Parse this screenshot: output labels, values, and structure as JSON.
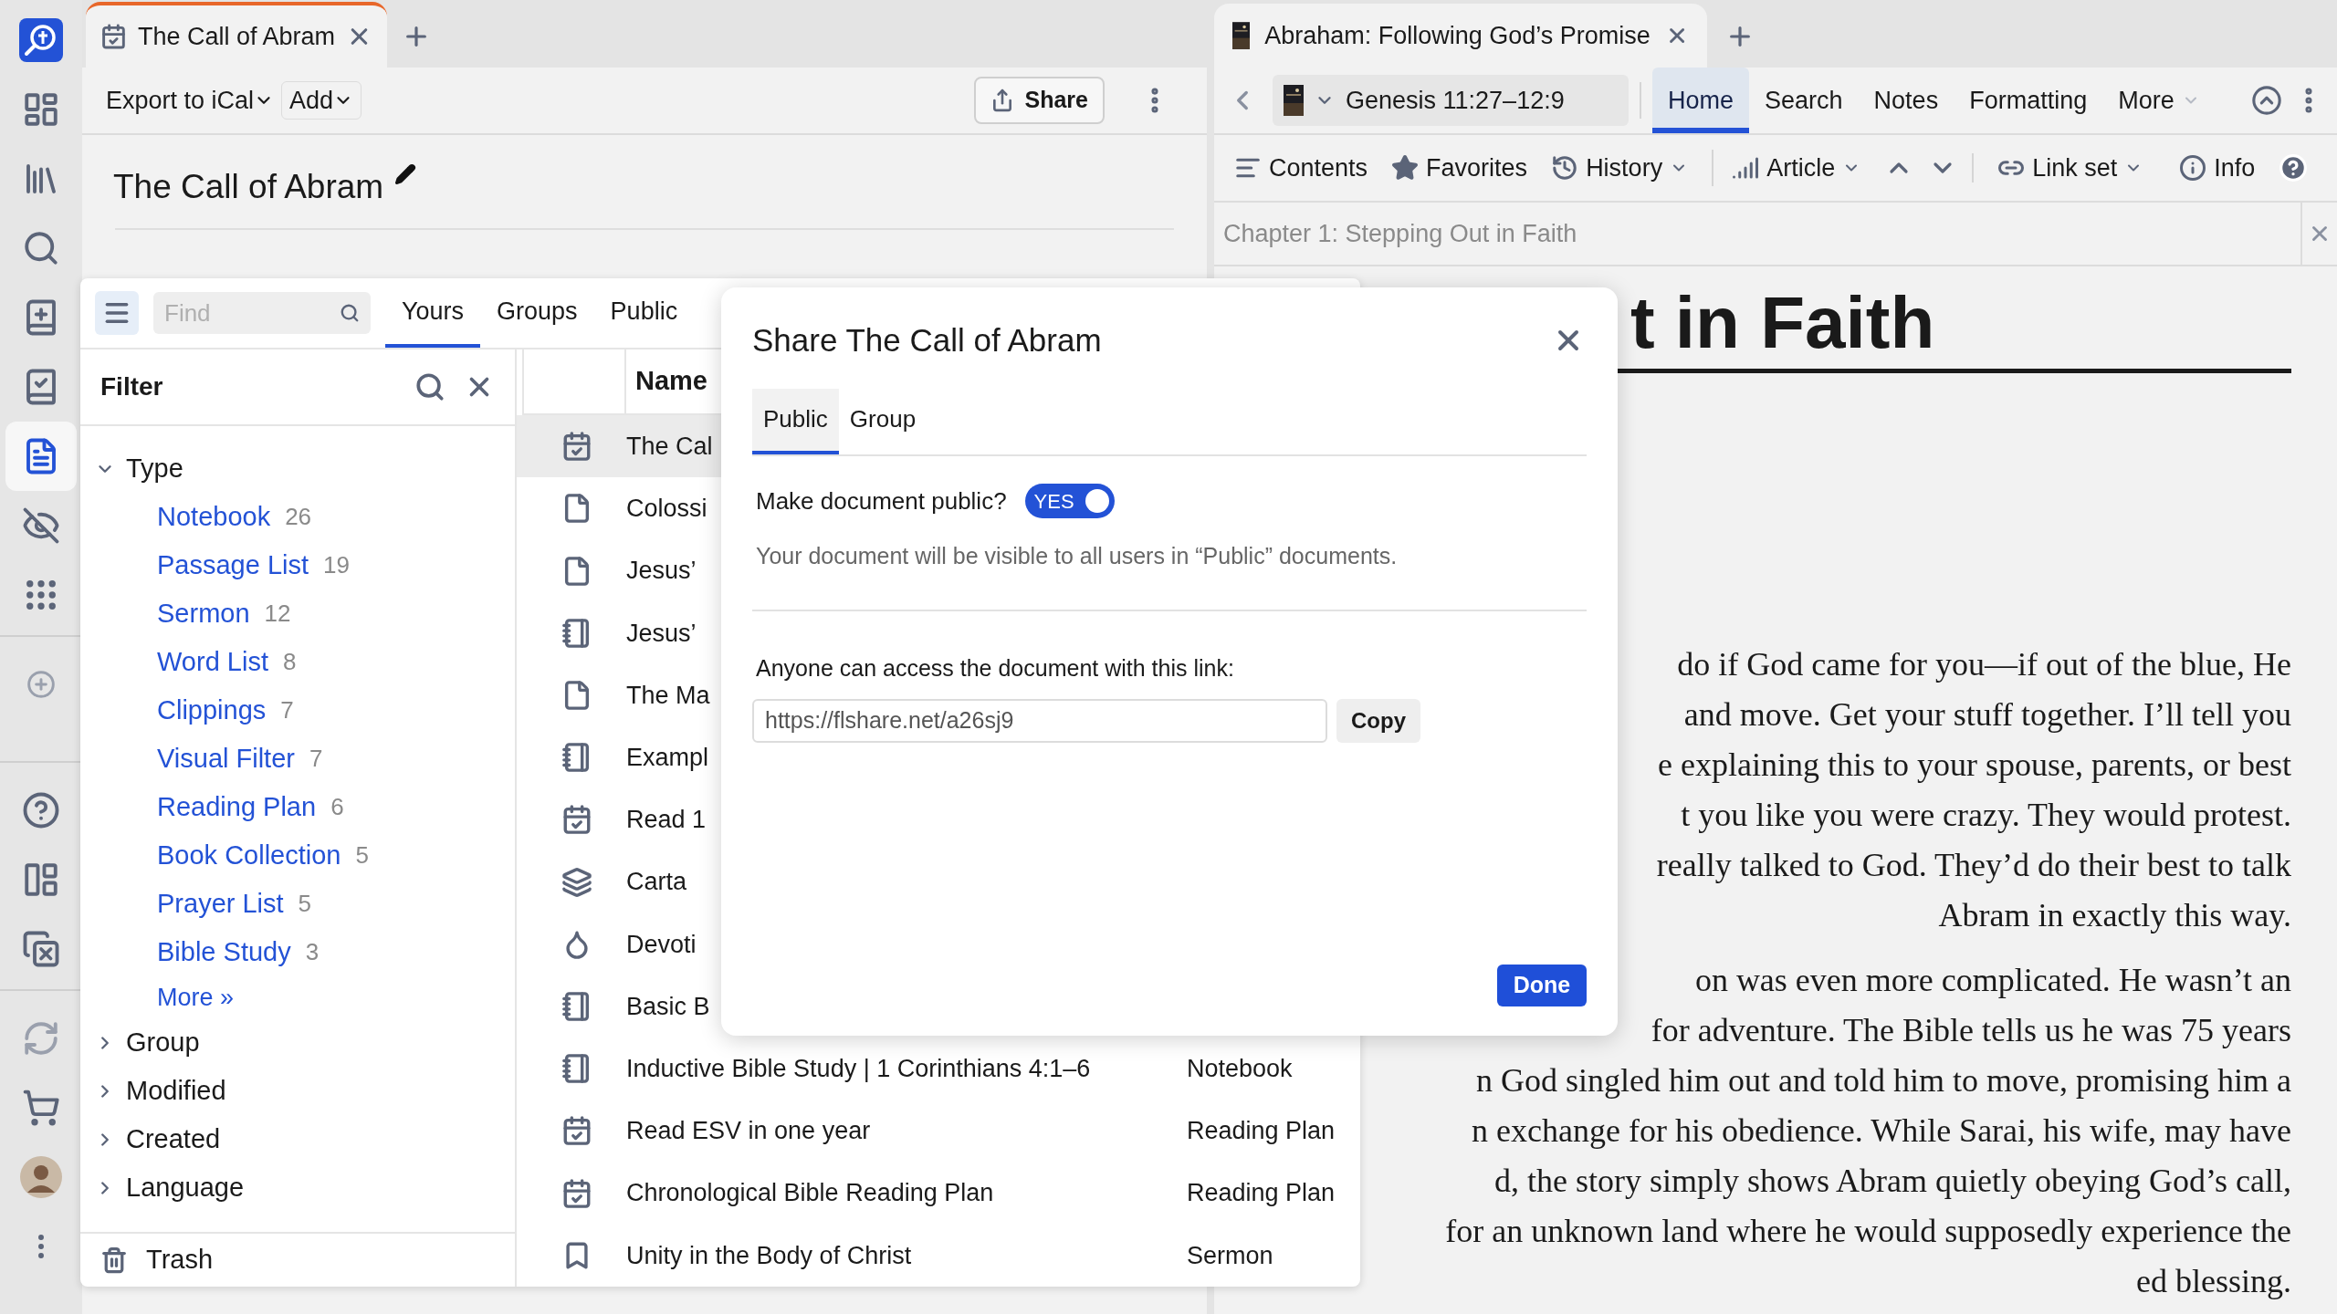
{
  "rail": [
    {
      "items": [
        {
          "kind": "logo",
          "selected": false
        },
        {
          "kind": "dashboard",
          "selected": false
        },
        {
          "kind": "library",
          "selected": false
        },
        {
          "kind": "search",
          "selected": false
        },
        {
          "kind": "add-book",
          "selected": false
        },
        {
          "kind": "check-book",
          "selected": false
        },
        {
          "kind": "document",
          "selected": true
        },
        {
          "kind": "eye-off",
          "selected": false
        },
        {
          "kind": "apps",
          "selected": false
        }
      ]
    },
    {
      "items": [
        {
          "kind": "add",
          "selected": false
        }
      ]
    },
    {
      "items": [
        {
          "kind": "help",
          "selected": false
        },
        {
          "kind": "layout",
          "selected": false
        },
        {
          "kind": "close-copy",
          "selected": false
        }
      ]
    },
    {
      "items": [
        {
          "kind": "sync",
          "selected": false
        },
        {
          "kind": "cart",
          "selected": false
        },
        {
          "kind": "avatar",
          "selected": false
        },
        {
          "kind": "more",
          "selected": false
        }
      ]
    }
  ],
  "left_window": {
    "tab": {
      "title": "The Call of Abram"
    },
    "toolbar": {
      "export": "Export to iCal",
      "add": "Add",
      "share": "Share"
    },
    "title": "The Call of Abram"
  },
  "right_window": {
    "tab": {
      "title": "Abraham: Following God’s Promise"
    },
    "reference": "Genesis 11:27–12:9",
    "nav_tabs": [
      {
        "label": "Home",
        "selected": true
      },
      {
        "label": "Search",
        "selected": false
      },
      {
        "label": "Notes",
        "selected": false
      },
      {
        "label": "Formatting",
        "selected": false
      },
      {
        "label": "More",
        "selected": false
      }
    ],
    "toolbar": [
      {
        "kind": "contents",
        "label": "Contents",
        "dropdown": false
      },
      {
        "kind": "favorites",
        "label": "Favorites",
        "dropdown": false
      },
      {
        "kind": "history",
        "label": "History",
        "dropdown": true
      },
      {
        "kind": "article",
        "label": "Article",
        "dropdown": true
      },
      {
        "kind": "updown"
      },
      {
        "kind": "linkset",
        "label": "Link set",
        "dropdown": true
      },
      {
        "kind": "info",
        "label": "Info",
        "dropdown": false
      },
      {
        "kind": "help"
      }
    ],
    "chapter": "Chapter 1: Stepping Out in Faith",
    "heading": "t in Faith",
    "paragraphs": [
      [
        "do if God came for you—if out of the blue, He",
        "and move. Get your stuff together. I’ll tell you",
        "e explaining this to your spouse, parents, or best",
        "t you like you were crazy. They would protest.",
        "really talked to God. They’d do their best to talk",
        "Abram in exactly this way."
      ],
      [
        "on was even more complicated. He wasn’t an",
        "for adventure. The Bible tells us he was 75 years",
        "n God singled him out and told him to move, promising him a",
        "n exchange for his obedience. While Sarai, his wife, may have",
        "d, the story simply shows Abram quietly obeying God’s call,",
        "for an unknown land where he would supposedly experience the",
        "ed blessing."
      ]
    ]
  },
  "documents": {
    "find": {
      "placeholder": "Find"
    },
    "tabs": [
      {
        "label": "Yours",
        "selected": true
      },
      {
        "label": "Groups",
        "selected": false
      },
      {
        "label": "Public",
        "selected": false
      }
    ],
    "filter": {
      "title": "Filter",
      "tree": [
        {
          "label": "Type",
          "expanded": true,
          "children": [
            {
              "label": "Notebook",
              "count": "26"
            },
            {
              "label": "Passage List",
              "count": "19"
            },
            {
              "label": "Sermon",
              "count": "12"
            },
            {
              "label": "Word List",
              "count": "8"
            },
            {
              "label": "Clippings",
              "count": "7"
            },
            {
              "label": "Visual Filter",
              "count": "7"
            },
            {
              "label": "Reading Plan",
              "count": "6"
            },
            {
              "label": "Book Collection",
              "count": "5"
            },
            {
              "label": "Prayer List",
              "count": "5"
            },
            {
              "label": "Bible Study",
              "count": "3"
            }
          ],
          "more": "More »"
        },
        {
          "label": "Group",
          "expanded": false
        },
        {
          "label": "Modified",
          "expanded": false
        },
        {
          "label": "Created",
          "expanded": false
        },
        {
          "label": "Language",
          "expanded": false
        }
      ],
      "trash": "Trash"
    },
    "table": {
      "columns": [
        "Name"
      ],
      "rows": [
        {
          "kind": "plan",
          "name": "The Cal",
          "selected": true
        },
        {
          "kind": "passage",
          "name": "Colossi",
          "selected": false
        },
        {
          "kind": "passage",
          "name": "Jesus’",
          "selected": false
        },
        {
          "kind": "notebook",
          "name": "Jesus’",
          "selected": false
        },
        {
          "kind": "passage",
          "name": "The Ma",
          "selected": false
        },
        {
          "kind": "notebook",
          "name": "Exampl",
          "selected": false
        },
        {
          "kind": "plan",
          "name": "Read 1",
          "selected": false
        },
        {
          "kind": "stack",
          "name": "Carta",
          "selected": false
        },
        {
          "kind": "drop",
          "name": "Devoti",
          "selected": false
        },
        {
          "kind": "notebook",
          "name": "Basic B",
          "selected": false
        },
        {
          "kind": "notebook",
          "name": "Inductive Bible Study | 1 Corinthians 4:1–6",
          "type": "Notebook",
          "selected": false
        },
        {
          "kind": "plan",
          "name": "Read ESV in one year",
          "type": "Reading Plan",
          "selected": false
        },
        {
          "kind": "plan",
          "name": "Chronological Bible Reading Plan",
          "type": "Reading Plan",
          "selected": false
        },
        {
          "kind": "sermon",
          "name": "Unity in the Body of Christ",
          "type": "Sermon",
          "selected": false
        }
      ]
    }
  },
  "dialog": {
    "title": "Share The Call of Abram",
    "tabs": [
      {
        "label": "Public",
        "selected": true
      },
      {
        "label": "Group",
        "selected": false
      }
    ],
    "toggle": {
      "label": "Make document public?",
      "on": true,
      "text": "YES"
    },
    "description": "Your document will be visible to all users in “Public” documents.",
    "link_label": "Anyone can access the document with this link:",
    "link": "https://flshare.net/a26sj9",
    "copy": "Copy",
    "done": "Done"
  }
}
